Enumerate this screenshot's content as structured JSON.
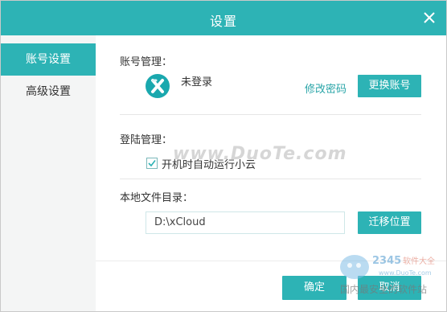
{
  "window": {
    "title": "设置",
    "close_icon": "close-icon"
  },
  "sidebar": {
    "items": [
      {
        "label": "账号设置",
        "active": true
      },
      {
        "label": "高级设置",
        "active": false
      }
    ]
  },
  "account": {
    "section_label": "账号管理：",
    "status": "未登录",
    "change_password": "修改密码",
    "switch_account": "更换账号"
  },
  "login": {
    "section_label": "登陆管理：",
    "autostart_label": "开机时自动运行小云",
    "autostart_checked": true
  },
  "storage": {
    "section_label": "本地文件目录：",
    "path_value": "D:\\xCloud",
    "migrate_button": "迁移位置"
  },
  "footer": {
    "ok": "确定",
    "cancel": "取消"
  },
  "watermark": {
    "main": "www.DuoTe.com",
    "logo_number": "2345",
    "logo_brand": "软件大全",
    "logo_url": "www.DuoTe.com",
    "logo_tagline": "国内最安全的软件站"
  },
  "colors": {
    "accent": "#2db3b5",
    "link": "#2aa5a8",
    "sidebar_bg": "#f4f5f5"
  }
}
